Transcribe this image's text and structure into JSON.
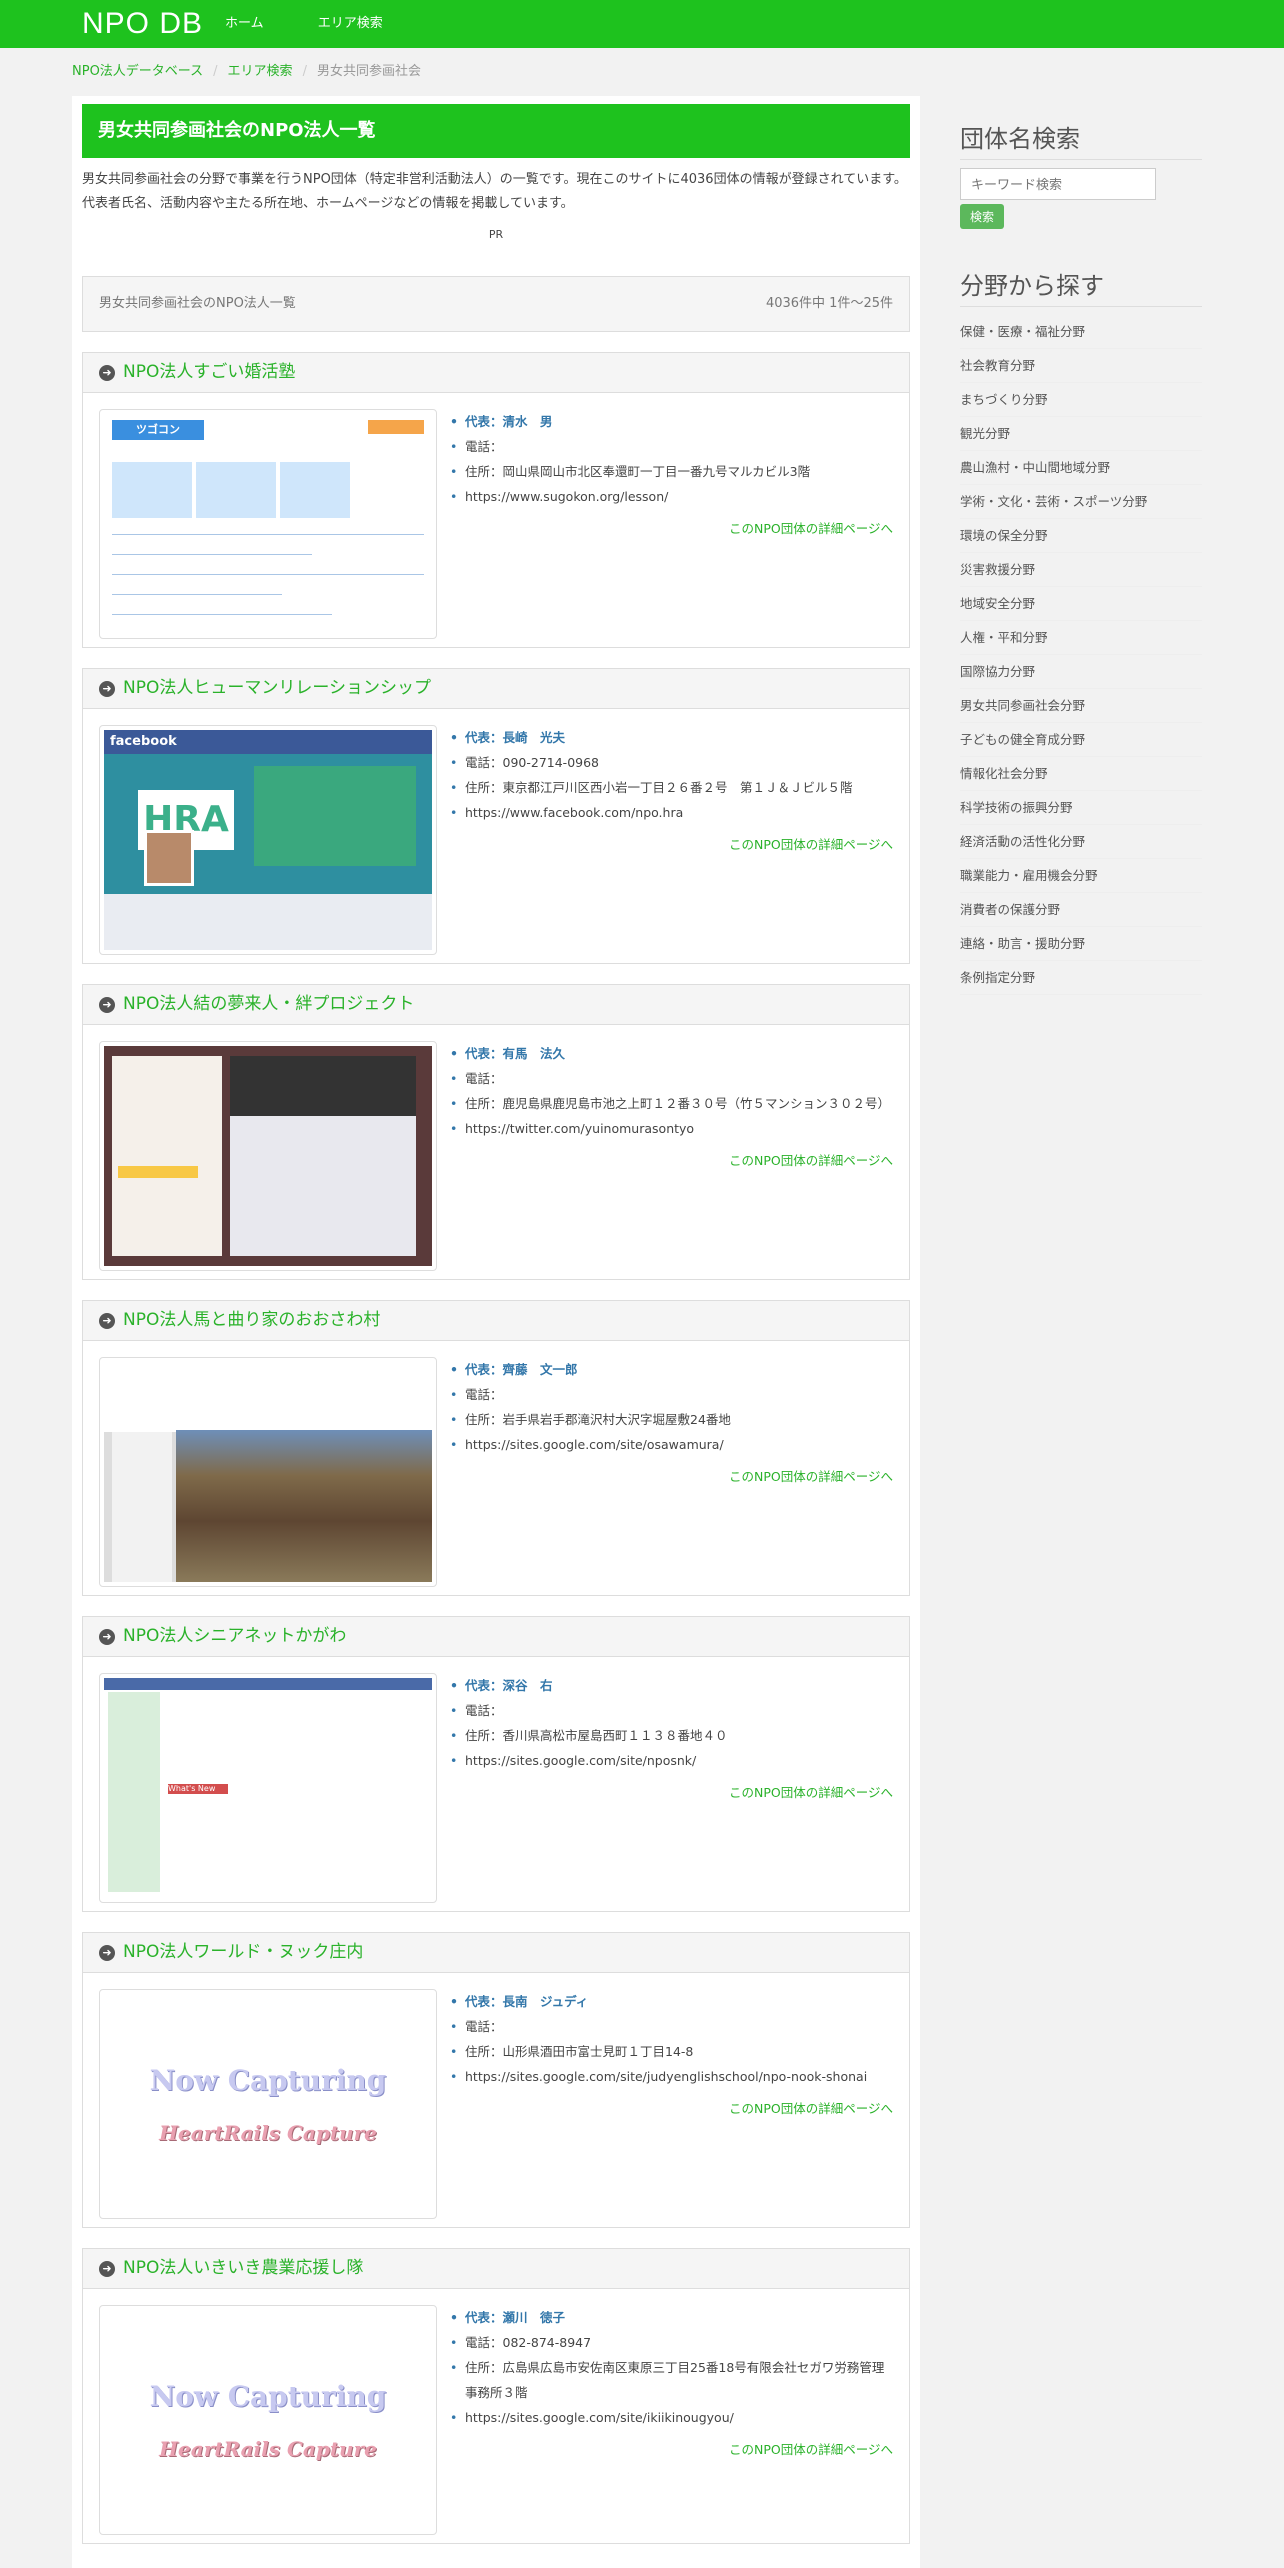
{
  "header": {
    "brand": "NPO DB",
    "nav": [
      "ホーム",
      "エリア検索"
    ]
  },
  "breadcrumb": [
    "NPO法人データベース",
    "エリア検索",
    "男女共同参画社会"
  ],
  "main": {
    "title": "男女共同参画社会のNPO法人一覧",
    "intro": "男女共同参画社会の分野で事業を行うNPO団体（特定非営利活動法人）の一覧です。現在このサイトに4036団体の情報が登録されています。代表者氏名、活動内容や主たる所在地、ホームページなどの情報を掲載しています。",
    "pr": "PR",
    "list_label": "男女共同参画社会のNPO法人一覧",
    "count_label": "4036件中 1件～25件",
    "detail_label": "このNPO団体の詳細ページへ",
    "orgs": [
      {
        "name": "NPO法人すごい婚活塾",
        "rep": "代表：清水　男",
        "tel": "電話：",
        "addr": "住所：岡山県岡山市北区奉還町一丁目一番九号マルカビル3階",
        "url": "https://www.sugokon.org/lesson/",
        "thumb_logo": "ツゴコン"
      },
      {
        "name": "NPO法人ヒューマンリレーションシップ",
        "rep": "代表：長崎　光夫",
        "tel": "電話：090-2714-0968",
        "addr": "住所：東京都江戸川区西小岩一丁目２６番２号　第１Ｊ＆Ｊビル５階",
        "url": "https://www.facebook.com/npo.hra",
        "thumb_fb": "facebook",
        "thumb_hra": "HRA"
      },
      {
        "name": "NPO法人結の夢来人・絆プロジェクト",
        "rep": "代表：有馬　法久",
        "tel": "電話：",
        "addr": "住所：鹿児島県鹿児島市池之上町１２番３０号（竹５マンション３０２号）",
        "url": "https://twitter.com/yuinomurasontyo"
      },
      {
        "name": "NPO法人馬と曲り家のおおさわ村",
        "rep": "代表：齊藤　文一郎",
        "tel": "電話：",
        "addr": "住所：岩手県岩手郡滝沢村大沢字堀屋敷24番地",
        "url": "https://sites.google.com/site/osawamura/"
      },
      {
        "name": "NPO法人シニアネットかがわ",
        "rep": "代表：深谷　右",
        "tel": "電話：",
        "addr": "住所：香川県高松市屋島西町１１３８番地４０",
        "url": "https://sites.google.com/site/nposnk/",
        "thumb_red": "What's New"
      },
      {
        "name": "NPO法人ワールド・ヌック庄内",
        "rep": "代表：長南　ジュディ",
        "tel": "電話：",
        "addr": "住所：山形県酒田市富士見町１丁目14-8",
        "url": "https://sites.google.com/site/judyenglishschool/npo-nook-shonai",
        "capture1": "Now Capturing",
        "capture2": "HeartRails Capture"
      },
      {
        "name": "NPO法人いきいき農業応援し隊",
        "rep": "代表：瀬川　徳子",
        "tel": "電話：082-874-8947",
        "addr": "住所：広島県広島市安佐南区東原三丁目25番18号有限会社セガワ労務管理事務所３階",
        "url": "https://sites.google.com/site/ikiikinougyou/",
        "capture1": "Now Capturing",
        "capture2": "HeartRails Capture"
      }
    ]
  },
  "sidebar": {
    "search_title": "団体名検索",
    "search_placeholder": "キーワード検索",
    "search_button": "検索",
    "cat_title": "分野から探す",
    "categories": [
      "保健・医療・福祉分野",
      "社会教育分野",
      "まちづくり分野",
      "観光分野",
      "農山漁村・中山間地域分野",
      "学術・文化・芸術・スポーツ分野",
      "環境の保全分野",
      "災害救援分野",
      "地域安全分野",
      "人権・平和分野",
      "国際協力分野",
      "男女共同参画社会分野",
      "子どもの健全育成分野",
      "情報化社会分野",
      "科学技術の振興分野",
      "経済活動の活性化分野",
      "職業能力・雇用機会分野",
      "消費者の保護分野",
      "連絡・助言・援助分野",
      "条例指定分野"
    ]
  },
  "colors": {
    "brand_green": "#1ec21e",
    "link_green": "#2ab22a",
    "rep_blue": "#3377aa"
  }
}
